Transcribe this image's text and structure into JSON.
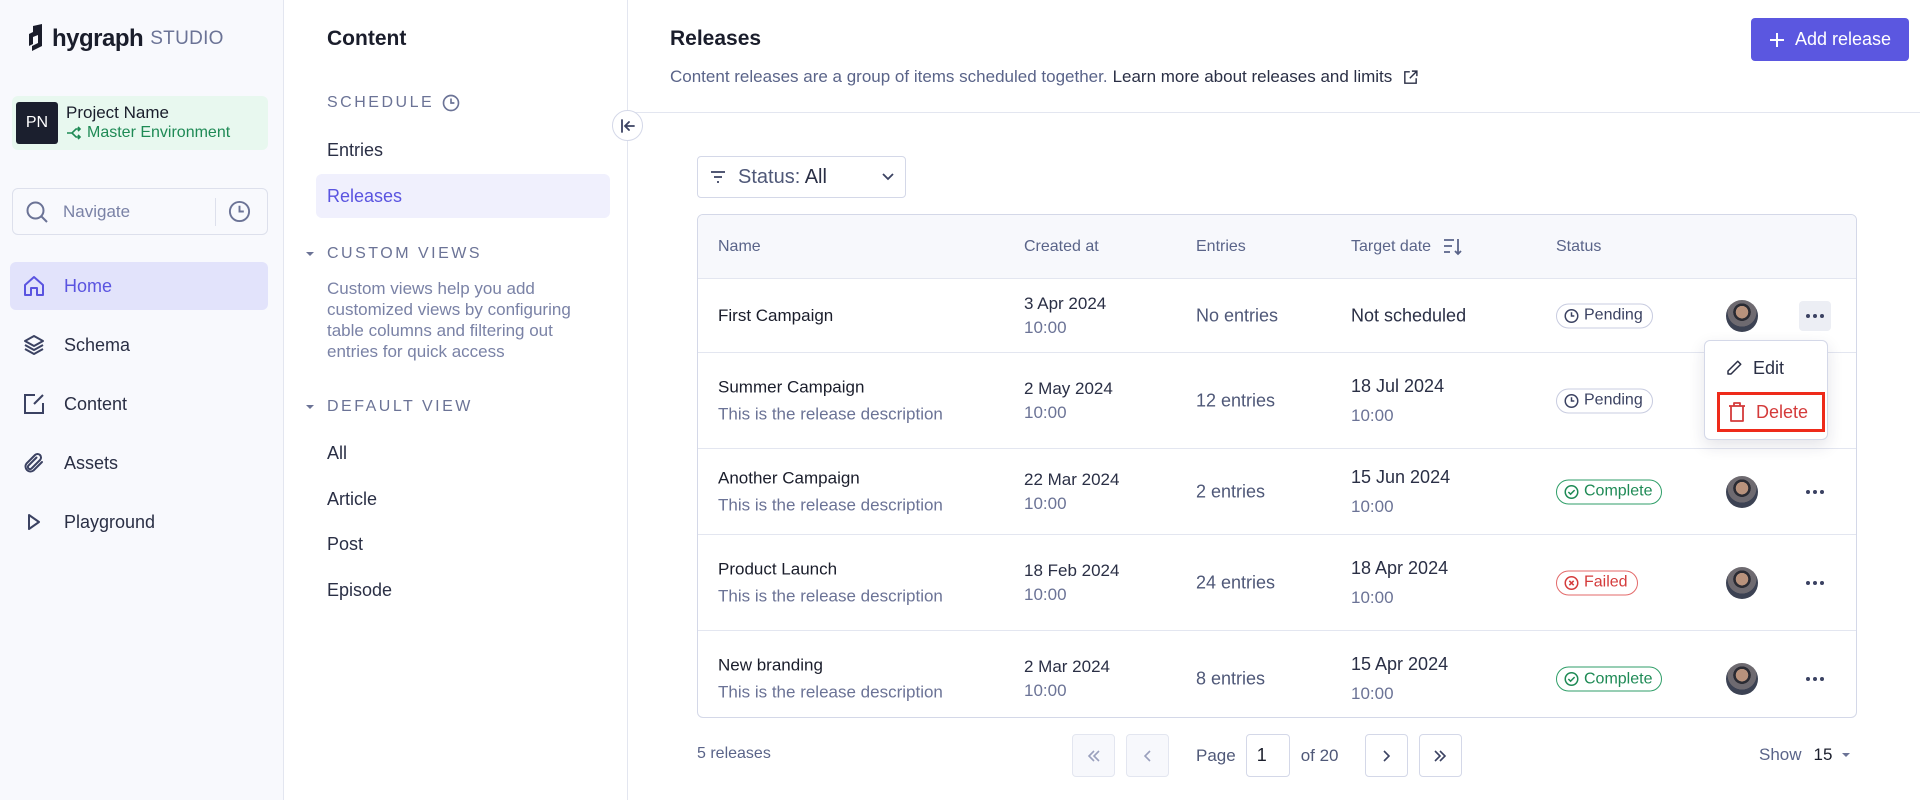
{
  "brand": {
    "name": "hygraph",
    "product": "STUDIO"
  },
  "project": {
    "initials": "PN",
    "name": "Project Name",
    "environment": "Master Environment"
  },
  "navigate": {
    "placeholder": "Navigate"
  },
  "nav": {
    "items": [
      {
        "label": "Home",
        "icon": "home-icon",
        "active": true
      },
      {
        "label": "Schema",
        "icon": "layers-icon",
        "active": false
      },
      {
        "label": "Content",
        "icon": "edit-square-icon",
        "active": false
      },
      {
        "label": "Assets",
        "icon": "paperclip-icon",
        "active": false
      },
      {
        "label": "Playground",
        "icon": "play-icon",
        "active": false
      }
    ]
  },
  "subnav": {
    "title": "Content",
    "schedule": {
      "heading": "SCHEDULE",
      "items": [
        {
          "label": "Entries",
          "active": false
        },
        {
          "label": "Releases",
          "active": true
        }
      ]
    },
    "custom_views": {
      "heading": "CUSTOM VIEWS",
      "description": "Custom views help you add customized views by configuring table columns and filtering out entries for quick access"
    },
    "default_view": {
      "heading": "DEFAULT VIEW",
      "items": [
        "All",
        "Article",
        "Post",
        "Episode"
      ]
    }
  },
  "header": {
    "title": "Releases",
    "description": "Content releases are a group of items scheduled together.",
    "learn_more": "Learn more about releases and limits",
    "add_button": "Add release"
  },
  "filter": {
    "label": "Status:",
    "value": "All"
  },
  "table": {
    "columns": {
      "name": "Name",
      "created": "Created at",
      "entries": "Entries",
      "target": "Target date",
      "status": "Status"
    },
    "rows": [
      {
        "name": "First Campaign",
        "description": "",
        "created_date": "3 Apr 2024",
        "created_time": "10:00",
        "entries": "No entries",
        "target_date": "Not scheduled",
        "target_time": "",
        "status": "Pending",
        "status_kind": "pending"
      },
      {
        "name": "Summer Campaign",
        "description": "This is the release description",
        "created_date": "2 May 2024",
        "created_time": "10:00",
        "entries": "12 entries",
        "target_date": "18 Jul 2024",
        "target_time": "10:00",
        "status": "Pending",
        "status_kind": "pending"
      },
      {
        "name": "Another Campaign",
        "description": "This is the release description",
        "created_date": "22 Mar 2024",
        "created_time": "10:00",
        "entries": "2 entries",
        "target_date": "15 Jun 2024",
        "target_time": "10:00",
        "status": "Complete",
        "status_kind": "complete"
      },
      {
        "name": "Product Launch",
        "description": "This is the release description",
        "created_date": "18 Feb 2024",
        "created_time": "10:00",
        "entries": "24 entries",
        "target_date": "18 Apr 2024",
        "target_time": "10:00",
        "status": "Failed",
        "status_kind": "failed"
      },
      {
        "name": "New branding",
        "description": "This is the release description",
        "created_date": "2 Mar 2024",
        "created_time": "10:00",
        "entries": "8 entries",
        "target_date": "15 Apr 2024",
        "target_time": "10:00",
        "status": "Complete",
        "status_kind": "complete"
      }
    ]
  },
  "row_menu": {
    "edit": "Edit",
    "delete": "Delete"
  },
  "footer": {
    "count": "5 releases",
    "page_label": "Page",
    "page_value": "1",
    "of_label": "of 20",
    "show_label": "Show",
    "show_value": "15"
  },
  "colors": {
    "accent": "#5b57e0",
    "pending": "#3b4262",
    "complete": "#1e8a55",
    "failed": "#d43b3b",
    "highlight": "#ee2a1a"
  }
}
